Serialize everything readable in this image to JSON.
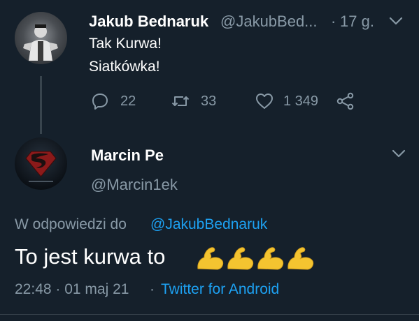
{
  "colors": {
    "background": "#15202b",
    "text_primary": "#ffffff",
    "text_secondary": "#8899a6",
    "link": "#1da1f2",
    "emoji": "#f4c430"
  },
  "parent_tweet": {
    "author_name": "Jakub Bednaruk",
    "author_handle": "@JakubBed...",
    "separator": "·",
    "time_ago": "17 g.",
    "text_lines": [
      "Tak Kurwa!",
      "Siatkówka!"
    ],
    "actions": {
      "reply": {
        "icon": "reply-icon",
        "count": "22"
      },
      "retweet": {
        "icon": "retweet-icon",
        "count": "33"
      },
      "like": {
        "icon": "heart-icon",
        "count": "1 349"
      },
      "share": {
        "icon": "share-icon"
      }
    }
  },
  "reply_tweet": {
    "author_name": "Marcin Pe",
    "author_handle": "@Marcin1ek",
    "reply_prefix": "W odpowiedzi do",
    "reply_to": "@JakubBednaruk",
    "text": "To jest kurwa to",
    "emojis": [
      "flexed-biceps-emoji",
      "flexed-biceps-emoji",
      "flexed-biceps-emoji",
      "flexed-biceps-emoji"
    ],
    "timestamp": "22:48 · 01 maj 21",
    "separator": "·",
    "source": "Twitter for Android"
  }
}
